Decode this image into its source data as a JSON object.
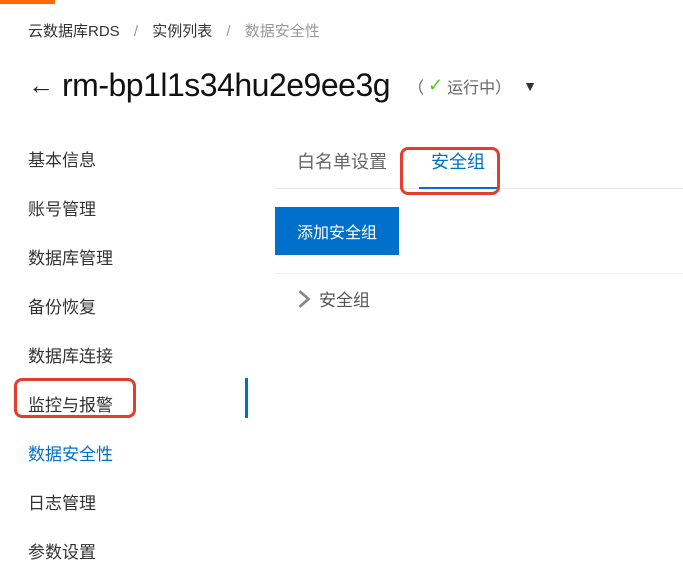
{
  "breadcrumb": {
    "root": "云数据库RDS",
    "list": "实例列表",
    "current": "数据安全性"
  },
  "header": {
    "instance_id": "rm-bp1l1s34hu2e9ee3g",
    "status_prefix": "（",
    "status_text": "运行中",
    "status_suffix": "）"
  },
  "sidebar": {
    "items": [
      {
        "label": "基本信息"
      },
      {
        "label": "账号管理"
      },
      {
        "label": "数据库管理"
      },
      {
        "label": "备份恢复"
      },
      {
        "label": "数据库连接"
      },
      {
        "label": "监控与报警"
      },
      {
        "label": "数据安全性"
      },
      {
        "label": "日志管理"
      },
      {
        "label": "参数设置"
      }
    ]
  },
  "tabs": {
    "whitelist": "白名单设置",
    "secgroup": "安全组"
  },
  "content": {
    "add_button": "添加安全组",
    "group_label": "安全组"
  }
}
